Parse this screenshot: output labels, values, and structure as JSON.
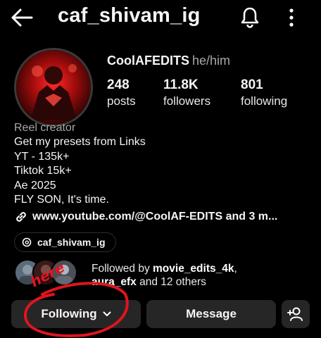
{
  "header": {
    "username": "caf_shivam_ig",
    "icons": [
      "back-arrow-icon",
      "bell-icon",
      "more-vertical-icon"
    ]
  },
  "profile": {
    "display_name": "CoolAFEDITS",
    "pronouns": "he/him",
    "stats": [
      {
        "count": "248",
        "label": "posts"
      },
      {
        "count": "11.8K",
        "label": "followers"
      },
      {
        "count": "801",
        "label": "following"
      }
    ],
    "category": "Reel creator",
    "bio": [
      "Get my presets from Links",
      "YT - 135k+",
      "Tiktok 15k+",
      "Ae 2025",
      "FLY SON, It's time."
    ],
    "link": "www.youtube.com/@CoolAF-EDITS and 3 m...",
    "threads_handle": "caf_shivam_ig"
  },
  "mutuals": {
    "prefix": "Followed by ",
    "user1": "movie_edits_4k",
    "sep": ",",
    "user2": "aura_efx",
    "suffix": " and 12 others"
  },
  "actions": {
    "following": "Following",
    "message": "Message"
  },
  "annotation": {
    "text": "here",
    "color": "#e0141e"
  },
  "colors": {
    "background": "#000000",
    "button": "#262626",
    "muted": "#a8a8a8"
  }
}
